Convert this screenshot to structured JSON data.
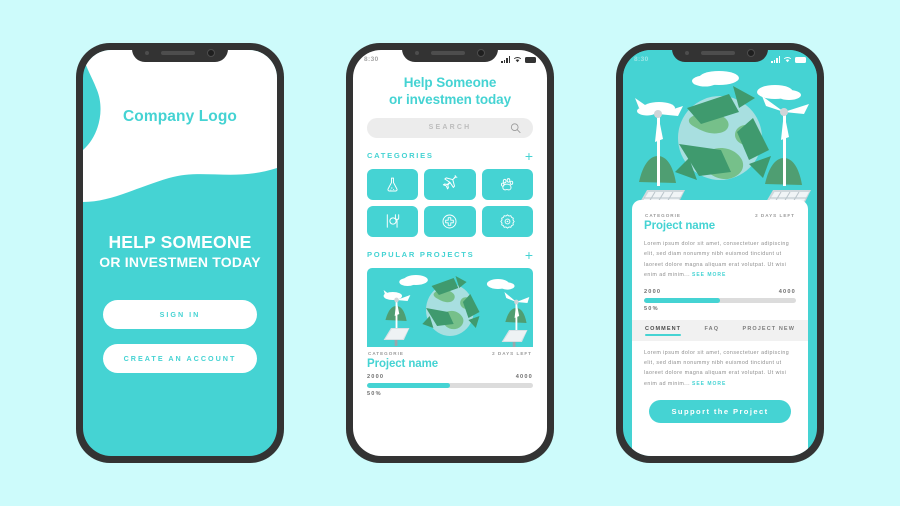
{
  "theme": {
    "teal": "#45d3d3",
    "page_bg": "#cdfbfb",
    "frame": "#333333",
    "muted": "#8e8e8e"
  },
  "status_bar": {
    "time": "8:30",
    "signal_icon": "signal-bars-icon",
    "wifi_icon": "wifi-icon",
    "battery_icon": "battery-icon"
  },
  "screen1": {
    "logo": "Company Logo",
    "headline_line1": "HELP SOMEONE",
    "headline_line2": "OR INVESTMEN TODAY",
    "sign_in_label": "SIGN IN",
    "create_account_label": "CREATE AN ACCOUNT"
  },
  "screen2": {
    "title_line1": "Help Someone",
    "title_line2": "or investmen today",
    "search": {
      "placeholder": "SEARCH",
      "icon": "search-icon"
    },
    "categories_heading": "CATEGORIES",
    "add_icon": "plus-icon",
    "categories": [
      {
        "name": "science",
        "icon": "flask-icon"
      },
      {
        "name": "travel",
        "icon": "airplane-icon"
      },
      {
        "name": "animals",
        "icon": "paw-icon"
      },
      {
        "name": "food",
        "icon": "cutlery-icon"
      },
      {
        "name": "health",
        "icon": "medical-cross-icon"
      },
      {
        "name": "technology",
        "icon": "gear-icon"
      }
    ],
    "popular_heading": "POPULAR PROJECTS",
    "project": {
      "image": "eco-globe-wind-turbine-illustration",
      "category": "CATEGORIE",
      "days_left": "2 DAYS LEFT",
      "name": "Project name",
      "current_amount": "2000",
      "goal_amount": "4000",
      "percent": "50%",
      "progress": 50
    }
  },
  "screen3": {
    "hero_image": "eco-globe-wind-turbine-illustration",
    "project": {
      "category": "CATEGORIE",
      "days_left": "2 DAYS LEFT",
      "name": "Project name",
      "description": "Lorem ipsum dolor sit amet, consectetuer adipiscing elit, sed diam nonummy nibh euismod tincidunt ut laoreet dolore magna aliquam erat volutpat. Ut wisi enim ad minim...",
      "see_more_label": "SEE MORE",
      "current_amount": "2000",
      "goal_amount": "4000",
      "percent": "50%",
      "progress": 50
    },
    "tabs": [
      {
        "label": "COMMENT",
        "active": true
      },
      {
        "label": "FAQ",
        "active": false
      },
      {
        "label": "PROJECT NEW",
        "active": false
      }
    ],
    "comment_text": "Lorem ipsum dolor sit amet, consectetuer adipiscing elit, sed diam nonummy nibh euismod tincidunt ut laoreet dolore magna aliquam erat volutpat. Ut wisi enim ad minim...",
    "comment_see_more": "SEE MORE",
    "support_button": "Support the Project"
  }
}
